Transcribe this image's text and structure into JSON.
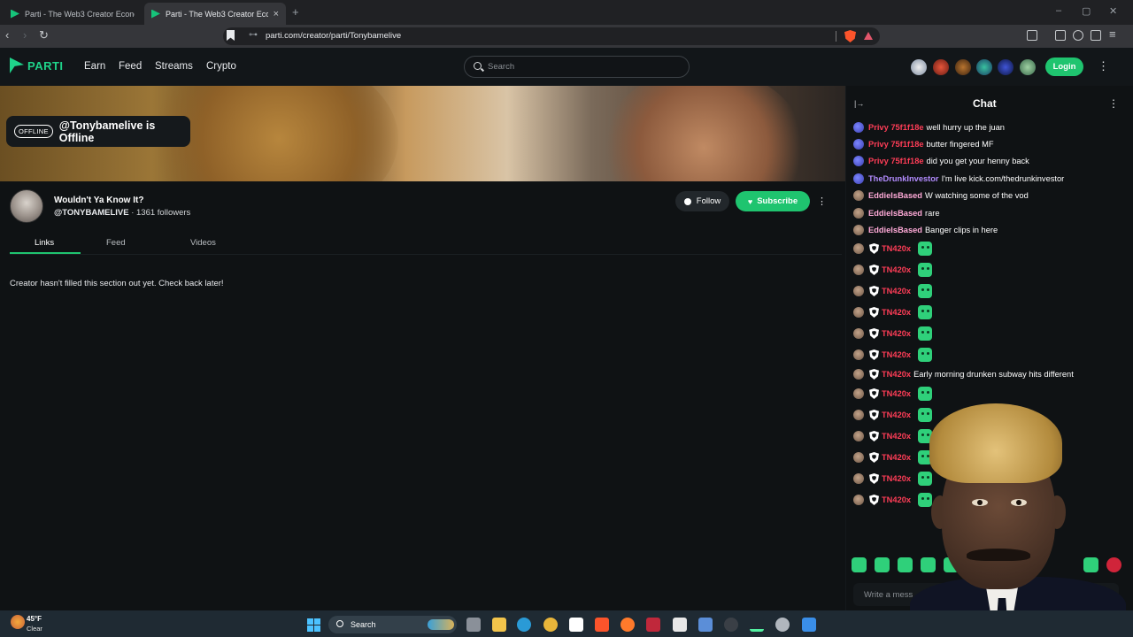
{
  "browser": {
    "tabs": [
      {
        "title": "Parti - The Web3 Creator Economy &"
      },
      {
        "title": "Parti - The Web3 Creator Econo"
      }
    ],
    "new_tab_symbol": "+",
    "close_symbol": "×",
    "url": "parti.com/creator/parti/Tonybamelive",
    "window_controls": [
      "–",
      "▢",
      "✕"
    ]
  },
  "site": {
    "logo": "PARTI",
    "nav": [
      "Earn",
      "Feed",
      "Streams",
      "Crypto"
    ],
    "search_placeholder": "Search",
    "login_label": "Login",
    "menu_symbol": "⋮"
  },
  "banner": {
    "offline_badge": "OFFLINE",
    "offline_text": "@Tonybamelive is Offline"
  },
  "profile": {
    "name": "Wouldn't Ya Know It?",
    "handle": "@TONYBAMELIVE",
    "followers": "· 1361 followers",
    "follow_label": "Follow",
    "subscribe_label": "Subscribe",
    "subscribe_icon": "♥",
    "menu_symbol": "⋮",
    "tabs": [
      "Links",
      "Feed",
      "Videos"
    ],
    "empty_message": "Creator hasn't filled this section out yet. Check back later!"
  },
  "chat": {
    "title": "Chat",
    "collapse_symbol": "|→",
    "menu_symbol": "⋮",
    "input_placeholder": "Write a mess",
    "messages": [
      {
        "user": "Privy 75f1f18e",
        "text": "well hurry up the juan",
        "color": "#ff3d57"
      },
      {
        "user": "Privy 75f1f18e",
        "text": "butter fingered MF",
        "color": "#ff3d57"
      },
      {
        "user": "Privy 75f1f18e",
        "text": "did you get your henny back",
        "color": "#ff3d57"
      },
      {
        "user": "TheDrunkInvestor",
        "text": "I'm live kick.com/thedrunkinvestor",
        "color": "#b38cff"
      },
      {
        "user": "EddieIsBased",
        "text": "W watching some of the vod",
        "color": "#ffaad8"
      },
      {
        "user": "EddieIsBased",
        "text": "rare",
        "color": "#ffaad8"
      },
      {
        "user": "EddieIsBased",
        "text": "Banger clips in here",
        "color": "#ffaad8"
      },
      {
        "user": "TN420x",
        "text": "",
        "color": "#ff3d57"
      },
      {
        "user": "TN420x",
        "text": "",
        "color": "#ff3d57"
      },
      {
        "user": "TN420x",
        "text": "",
        "color": "#ff3d57"
      },
      {
        "user": "TN420x",
        "text": "",
        "color": "#ff3d57"
      },
      {
        "user": "TN420x",
        "text": "",
        "color": "#ff3d57"
      },
      {
        "user": "TN420x",
        "text": "",
        "color": "#ff3d57"
      },
      {
        "user": "TN420x",
        "text": "Early morning drunken subway hits different",
        "color": "#ff3d57"
      },
      {
        "user": "TN420x",
        "text": "",
        "color": "#ff3d57"
      },
      {
        "user": "TN420x",
        "text": "",
        "color": "#ff3d57"
      },
      {
        "user": "TN420x",
        "text": "",
        "color": "#ff3d57"
      },
      {
        "user": "TN420x",
        "text": "",
        "color": "#ff3d57"
      },
      {
        "user": "TN420x",
        "text": "",
        "color": "#ff3d57"
      },
      {
        "user": "TN420x",
        "text": "",
        "color": "#ff3d57"
      }
    ]
  },
  "taskbar": {
    "weather_temp": "45°F",
    "weather_cond": "Clear",
    "search_label": "Search"
  },
  "colors": {
    "accent": "#1fc46f",
    "background": "#0f1214"
  }
}
